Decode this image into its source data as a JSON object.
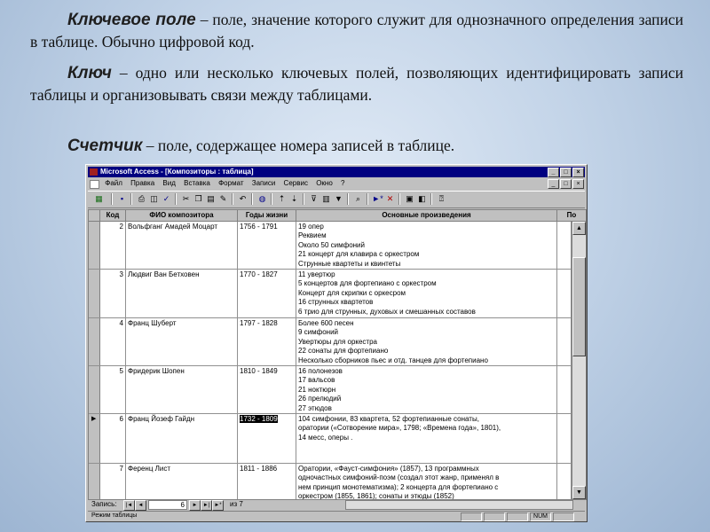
{
  "slide": {
    "p1_term": "Ключевое поле",
    "p1_text": " – поле, значение которого служит для однозначного определения записи в таблице. Обычно цифровой код.",
    "p2_term": "Ключ",
    "p2_text": " – одно или несколько ключевых полей, позволяющих идентифицировать записи таблицы и организовывать связи между таблицами.",
    "p3_term": "Счетчик",
    "p3_text": " – поле, содержащее номера записей в таблице."
  },
  "window": {
    "title": "Microsoft Access - [Композиторы : таблица]",
    "buttons": [
      "_",
      "□",
      "×"
    ]
  },
  "menu": [
    "Файл",
    "Правка",
    "Вид",
    "Вставка",
    "Формат",
    "Записи",
    "Сервис",
    "Окно",
    "?"
  ],
  "table": {
    "columns": [
      "Код",
      "ФИО композитора",
      "Годы жизни",
      "Основные произведения",
      "По"
    ],
    "rows": [
      {
        "kod": "2",
        "fio": "Вольфганг Амадей Моцарт",
        "years": "1756 - 1791",
        "works": [
          "19 опер",
          "Реквием",
          "Около 50 симфоний",
          "21 концерт для клавира с оркестром",
          "Струнные квартеты и квинтеты"
        ]
      },
      {
        "kod": "3",
        "fio": "Людвиг Ван Бетховен",
        "years": "1770 - 1827",
        "works": [
          "11 увертюр",
          "5 концертов для фортепиано с оркестром",
          " Концерт для скрипки с оркесром",
          "16 струнных квартетов",
          "6 трио для струнных, духовых и смешанных составов"
        ]
      },
      {
        "kod": "4",
        "fio": "Франц Шуберт",
        "years": "1797 - 1828",
        "works": [
          "Более 600 песен",
          "9 симфоний",
          "Увертюры для оркестра",
          "22 сонаты для фортепиано",
          "Несколько сборников пьес и отд. танцев для фортепиано"
        ]
      },
      {
        "kod": "5",
        "fio": "Фридерик Шопен",
        "years": "1810 - 1849",
        "works": [
          "16 полонезов",
          "17 вальсов",
          "21 ноктюрн",
          "26 прелюдий",
          "27 этюдов"
        ]
      },
      {
        "kod": "6",
        "fio": "Франц Йозеф Гайдн",
        "years": "1732 - 1809",
        "works": [
          "104 симфонии, 83 квартета, 52 фортепианные сонаты,",
          "оратории («Сотворение мира», 1798; «Времена года», 1801),",
          "14 месс, оперы ."
        ]
      },
      {
        "kod": "7",
        "fio": "Ференц Лист",
        "years": "1811 - 1886",
        "works": [
          "Оратории, «Фауст-симфония» (1857), 13 программных",
          "одночастных симфоний-поэм (создал этот жанр, применял в",
          "нем принцип монотематизма); 2 концерта для фортепиано с",
          "оркестром (1855, 1861); сонаты и этюды (1852)"
        ]
      }
    ]
  },
  "navigation": {
    "label": "Запись:",
    "current": "6",
    "total": "из 7",
    "btn_first": "|◄",
    "btn_prev": "◄",
    "btn_next": "►",
    "btn_last": "►|",
    "btn_new": "►*"
  },
  "status": {
    "mode": "Режим таблицы",
    "num": "NUM"
  }
}
